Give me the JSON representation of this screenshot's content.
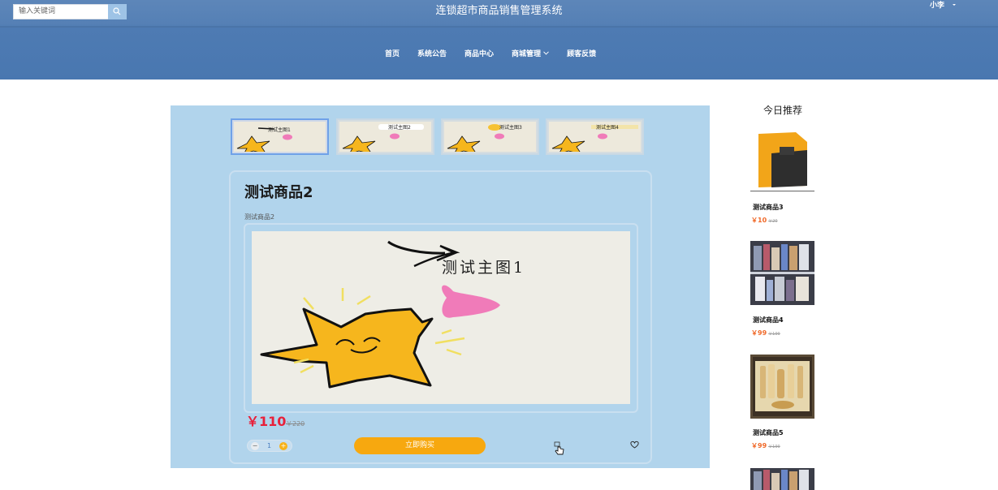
{
  "header": {
    "search_placeholder": "输入关键词",
    "site_title": "连锁超市商品销售管理系统",
    "user_name": "小李"
  },
  "nav": {
    "items": [
      {
        "label": "首页"
      },
      {
        "label": "系统公告"
      },
      {
        "label": "商品中心"
      },
      {
        "label": "商城管理"
      },
      {
        "label": "顾客反馈"
      }
    ]
  },
  "product": {
    "name": "测试商品2",
    "subtitle": "测试商品2",
    "image_caption": "测试主图1",
    "price": "￥110",
    "old_price": "￥220",
    "quantity": "1",
    "buy_label": "立即购买",
    "thumbnails": [
      {
        "caption": "测试主图1",
        "active": true
      },
      {
        "caption": "测试主图2",
        "active": false
      },
      {
        "caption": "测试主图3",
        "active": false
      },
      {
        "caption": "测试主图4",
        "active": false
      }
    ]
  },
  "recommend": {
    "title": "今日推荐",
    "items": [
      {
        "name": "测试商品3",
        "price": "￥10",
        "old_price": "￥20"
      },
      {
        "name": "测试商品4",
        "price": "￥99",
        "old_price": "￥199"
      },
      {
        "name": "测试商品5",
        "price": "￥99",
        "old_price": "￥199"
      }
    ]
  },
  "colors": {
    "header": "#4977b0",
    "panel": "#b1d4ec",
    "price": "#e8203a",
    "buy_button": "#f7a80f",
    "rec_price": "#f06a2a"
  }
}
